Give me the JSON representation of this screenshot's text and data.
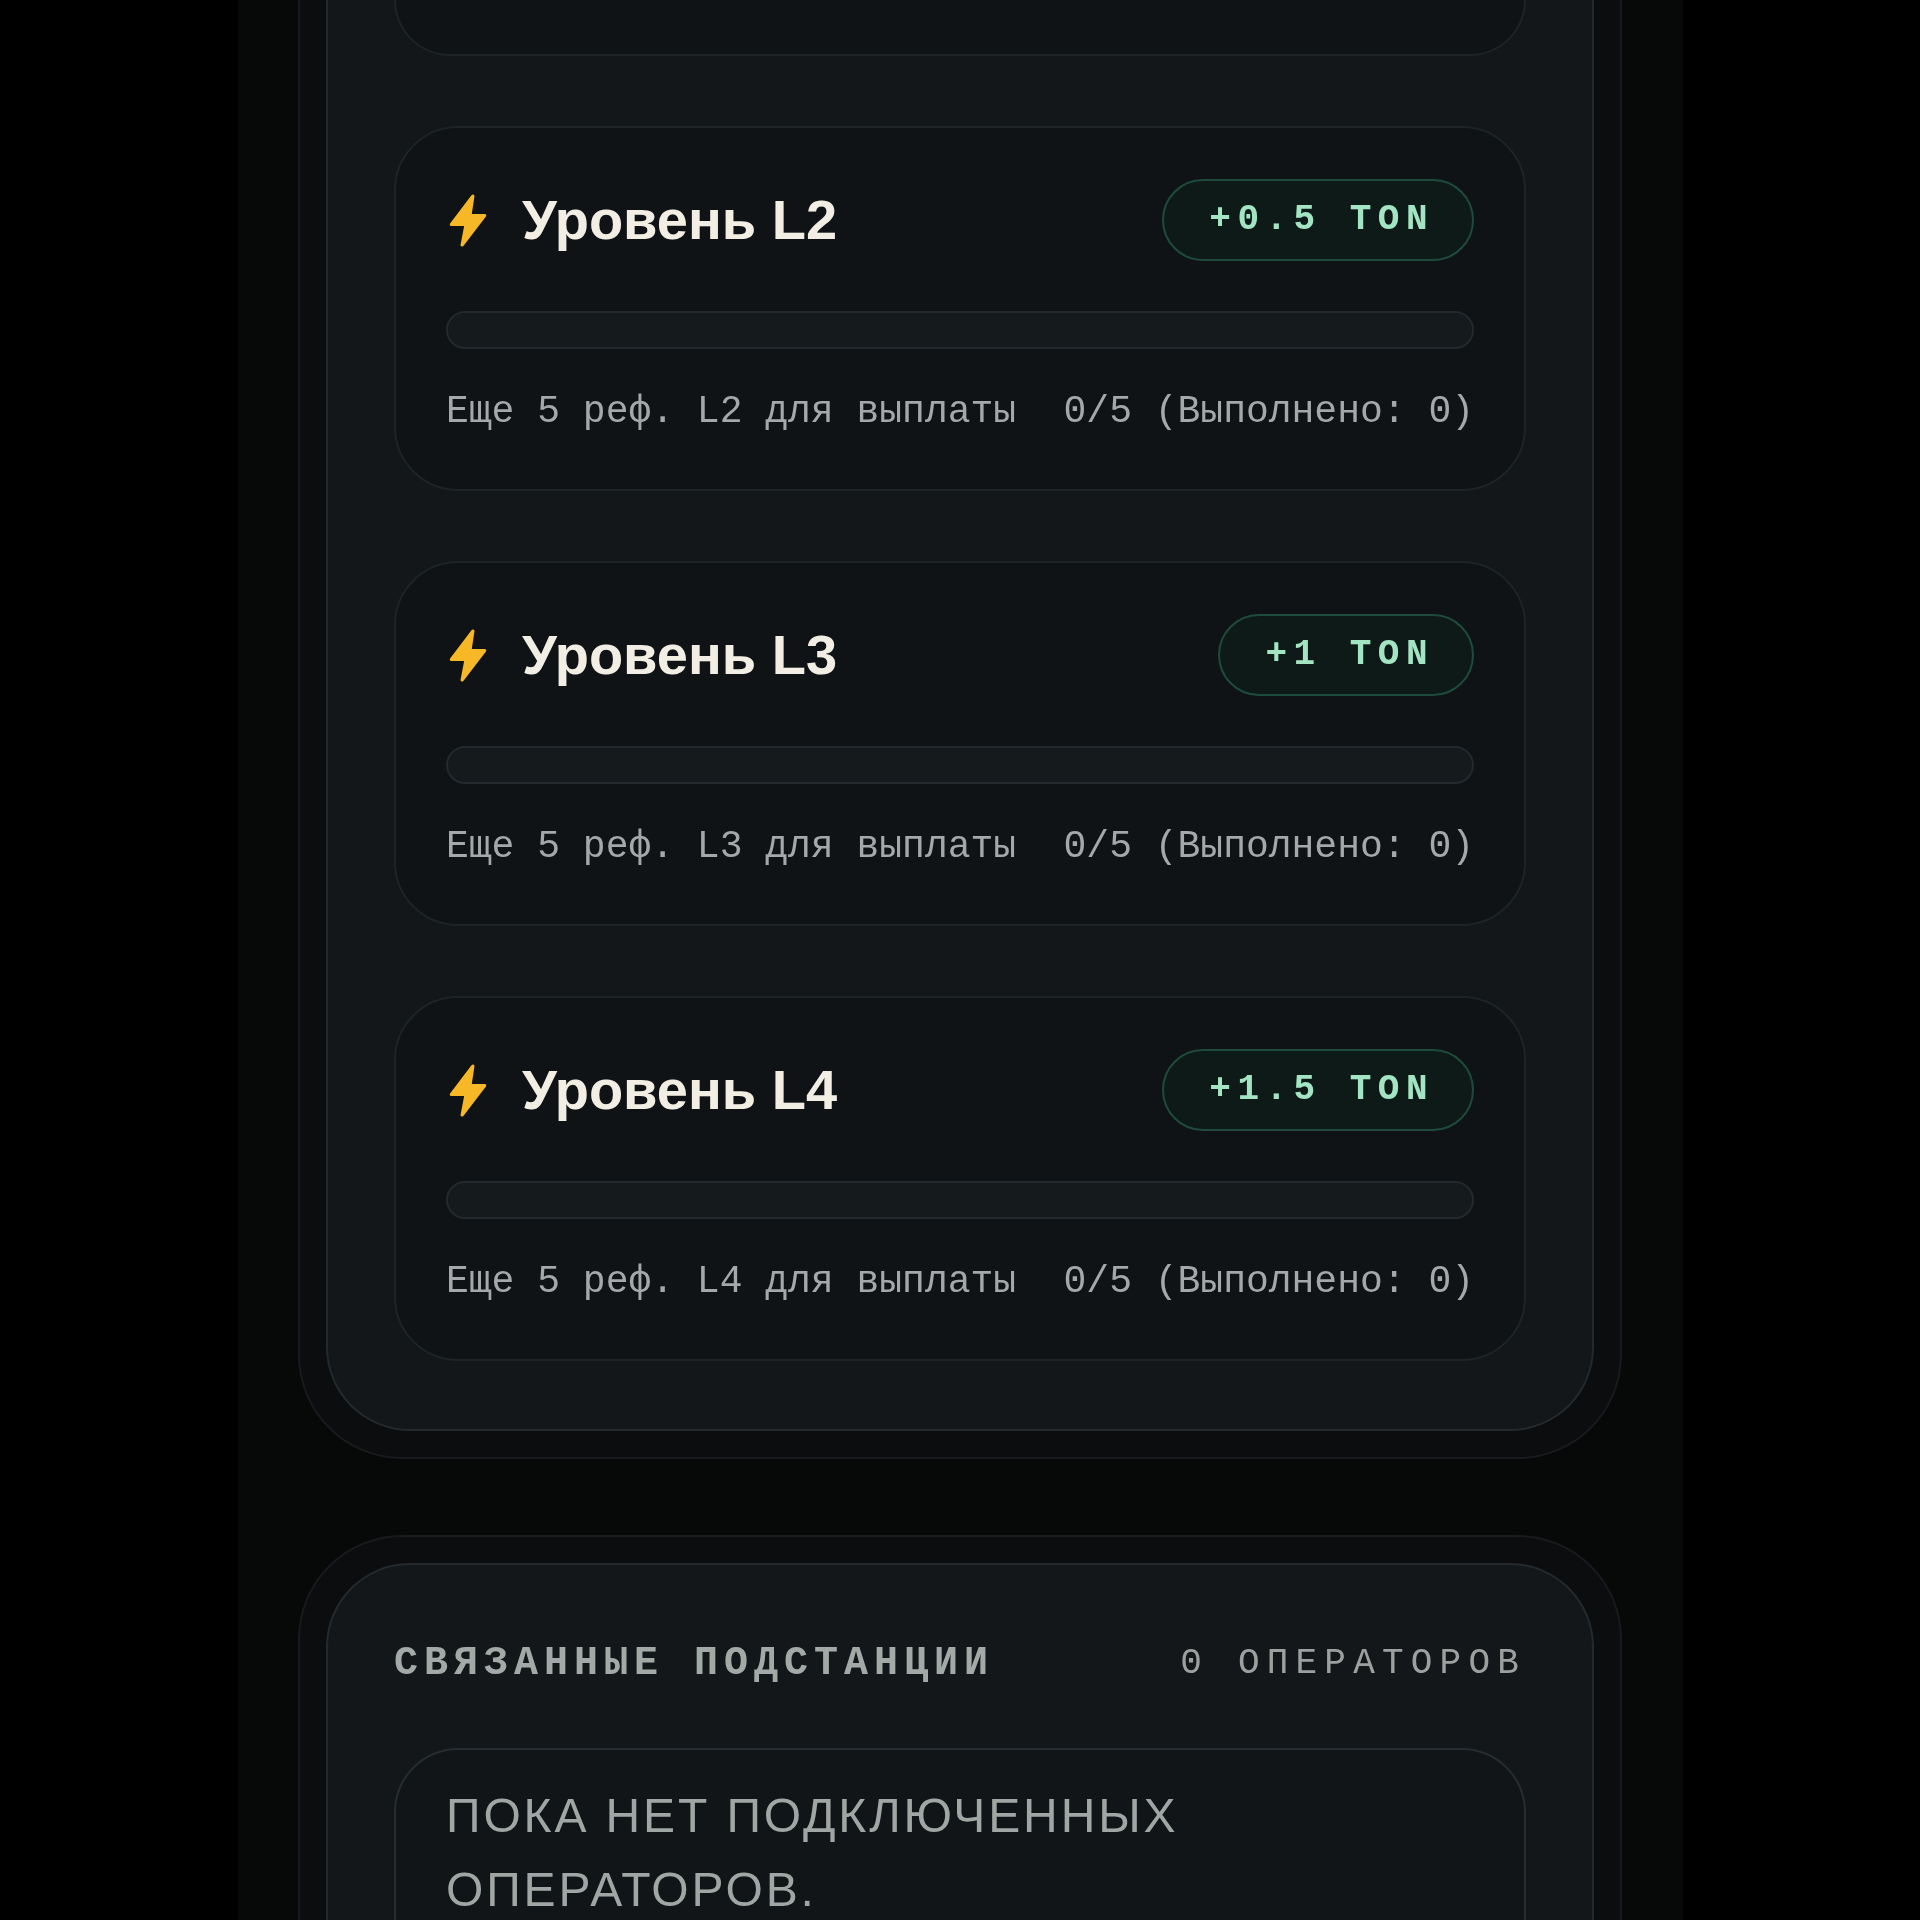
{
  "levels": [
    {
      "title": "Уровень L2",
      "reward": "+0.5 TON",
      "remaining": "Еще 5 реф. L2 для выплаты",
      "progress": "0/5 (Выполнено: 0)"
    },
    {
      "title": "Уровень L3",
      "reward": "+1 TON",
      "remaining": "Еще 5 реф. L3 для выплаты",
      "progress": "0/5 (Выполнено: 0)"
    },
    {
      "title": "Уровень L4",
      "reward": "+1.5 TON",
      "remaining": "Еще 5 реф. L4 для выплаты",
      "progress": "0/5 (Выполнено: 0)"
    }
  ],
  "linked_substations": {
    "title": "СВЯЗАННЫЕ ПОДСТАНЦИИ",
    "count": "0 ОПЕРАТОРОВ",
    "empty_message": "ПОКА НЕТ ПОДКЛЮЧЕННЫХ ОПЕРАТОРОВ."
  }
}
